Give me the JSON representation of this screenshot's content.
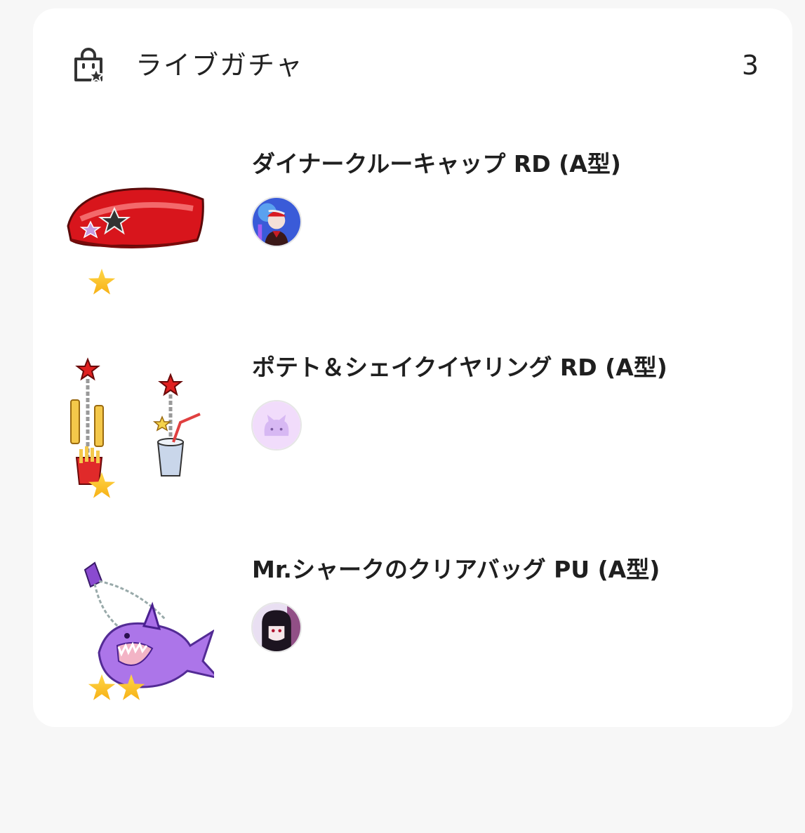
{
  "header": {
    "icon": "shopping-bag-star-icon",
    "title": "ライブガチャ",
    "count": "3"
  },
  "items": [
    {
      "name": "ダイナークルーキャップ RD (A型)",
      "thumbnail_icon": "red-cap-icon",
      "rarity_stars": 1,
      "avatar_icon": "user-avatar-icon"
    },
    {
      "name": "ポテト＆シェイクイヤリング RD (A型)",
      "thumbnail_icon": "earrings-icon",
      "rarity_stars": 1,
      "avatar_icon": "user-avatar-icon"
    },
    {
      "name": "Mr.シャークのクリアバッグ PU (A型)",
      "thumbnail_icon": "shark-bag-icon",
      "rarity_stars": 2,
      "avatar_icon": "user-avatar-icon"
    }
  ],
  "colors": {
    "card_background": "#ffffff",
    "page_background": "#f7f7f7",
    "star_gold": "#f6ae12"
  }
}
